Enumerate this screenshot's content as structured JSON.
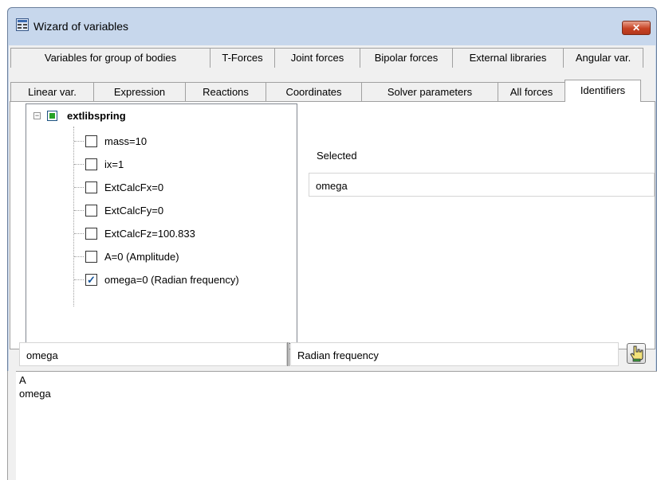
{
  "window": {
    "title": "Wizard of variables",
    "close_label": "✕"
  },
  "tabs_row1": [
    "Variables for group of bodies",
    "T-Forces",
    "Joint forces",
    "Bipolar forces",
    "External libraries",
    "Angular var."
  ],
  "tabs_row2": [
    "Linear var.",
    "Expression",
    "Reactions",
    "Coordinates",
    "Solver parameters",
    "All forces",
    "Identifiers"
  ],
  "active_tab": "Identifiers",
  "tree": {
    "root": "extlibspring",
    "items": [
      {
        "label": "mass=10",
        "checked": false
      },
      {
        "label": "ix=1",
        "checked": false
      },
      {
        "label": "ExtCalcFx=0",
        "checked": false
      },
      {
        "label": "ExtCalcFy=0",
        "checked": false
      },
      {
        "label": "ExtCalcFz=100.833",
        "checked": false
      },
      {
        "label": "A=0 (Amplitude)",
        "checked": false
      },
      {
        "label": "omega=0 (Radian frequency)",
        "checked": true
      }
    ]
  },
  "selected": {
    "label": "Selected",
    "value": "omega"
  },
  "bottom": {
    "name_value": "omega",
    "description_value": "Radian frequency"
  },
  "memo_lines": [
    "A",
    "omega"
  ],
  "icons": {
    "app": "app-icon",
    "close": "close-icon",
    "hand": "hand-pointer-icon"
  }
}
